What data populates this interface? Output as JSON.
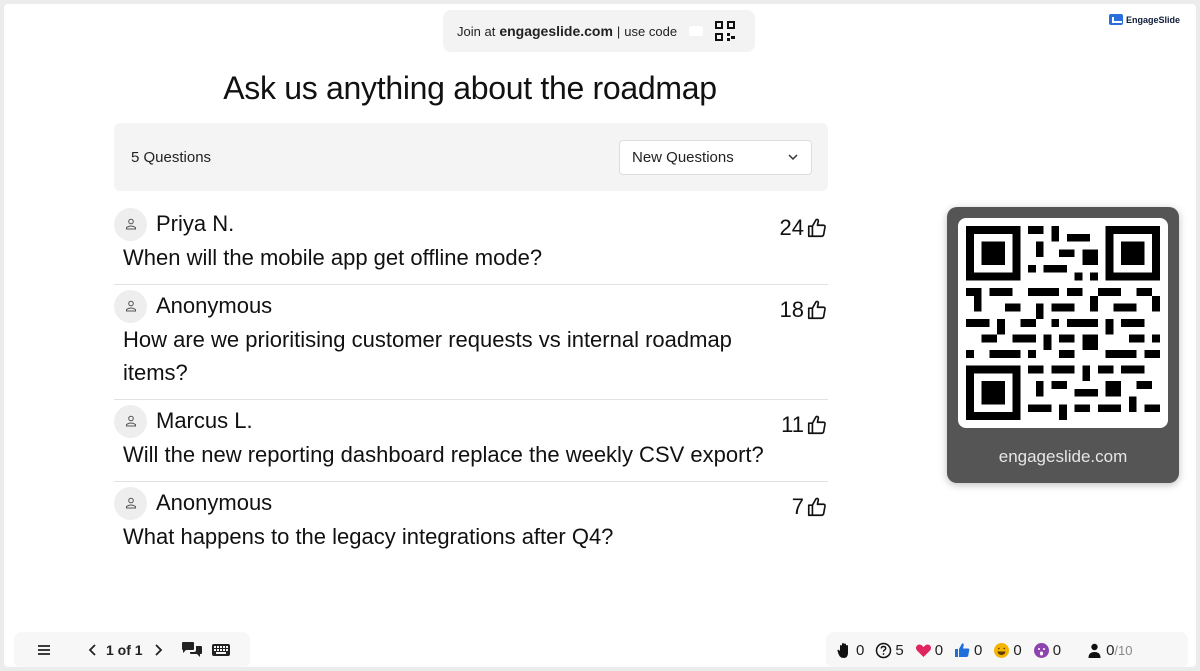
{
  "banner": {
    "join_prefix": "Join at",
    "join_domain": "engageslide.com",
    "use_code": "use code"
  },
  "brand": {
    "name": "EngageSlide"
  },
  "title": "Ask us anything about the roadmap",
  "toolbar": {
    "count_label": "5 Questions",
    "sort_value": "New Questions"
  },
  "questions": [
    {
      "author": "Priya N.",
      "text": "When will the mobile app get offline mode?",
      "votes": "24"
    },
    {
      "author": "Anonymous",
      "text": "How are we prioritising customer requests vs internal roadmap items?",
      "votes": "18"
    },
    {
      "author": "Marcus L.",
      "text": "Will the new reporting dashboard replace the weekly CSV export?",
      "votes": "11"
    },
    {
      "author": "Anonymous",
      "text": "What happens to the legacy integrations after Q4?",
      "votes": "7"
    }
  ],
  "qr_card": {
    "url": "engageslide.com"
  },
  "nav": {
    "page_label": "1 of 1"
  },
  "reactions": {
    "hand": "0",
    "questions": "5",
    "heart": "0",
    "thumbs_up": "0",
    "laugh": "0",
    "wow": "0",
    "participants": "0",
    "participants_total": "/10"
  },
  "colors": {
    "heart": "#e0245e",
    "thumbs": "#1e6fd9",
    "laugh": "#f4b400",
    "wow": "#8e44ad",
    "qr_card_bg": "#555555"
  }
}
